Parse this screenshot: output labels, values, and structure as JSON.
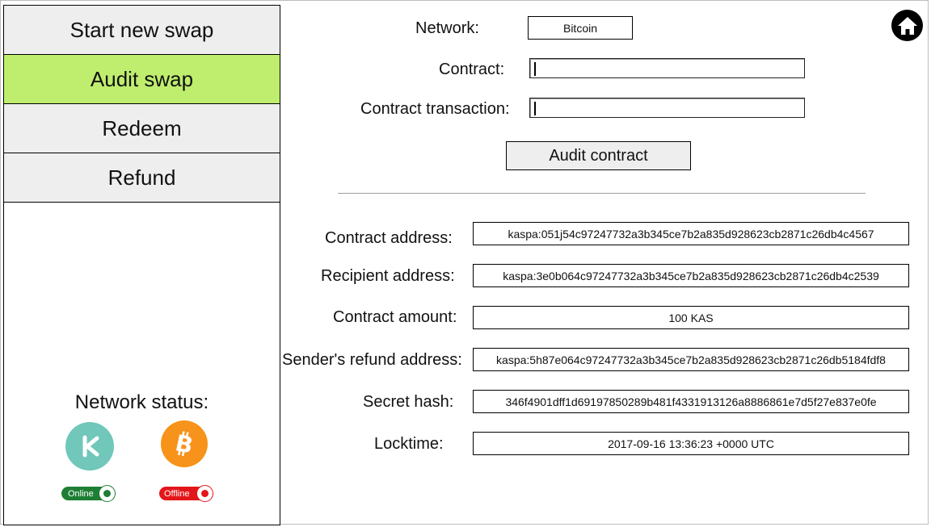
{
  "sidebar": {
    "items": [
      {
        "label": "Start new swap"
      },
      {
        "label": "Audit swap"
      },
      {
        "label": "Redeem"
      },
      {
        "label": "Refund"
      }
    ],
    "network_status_label": "Network status:",
    "kaspa_status": "Online",
    "bitcoin_status": "Offline"
  },
  "form": {
    "network_label": "Network:",
    "network_value": "Bitcoin",
    "contract_label": "Contract:",
    "contract_value": "",
    "contract_tx_label": "Contract transaction:",
    "contract_tx_value": "",
    "audit_button": "Audit contract"
  },
  "results": {
    "contract_address_label": "Contract address:",
    "contract_address": "kaspa:051j54c97247732a3b345ce7b2a835d928623cb2871c26db4c4567",
    "recipient_address_label": "Recipient address:",
    "recipient_address": "kaspa:3e0b064c97247732a3b345ce7b2a835d928623cb2871c26db4c2539",
    "contract_amount_label": "Contract amount:",
    "contract_amount": "100 KAS",
    "refund_address_label": "Sender's refund address:",
    "refund_address": "kaspa:5h87e064c97247732a3b345ce7b2a835d928623cb2871c26db5184fdf8",
    "secret_hash_label": "Secret hash:",
    "secret_hash": "346f4901dff1d69197850289b481f4331913126a8886861e7d5f27e837e0fe",
    "locktime_label": "Locktime:",
    "locktime": "2017-09-16 13:36:23 +0000 UTC"
  },
  "colors": {
    "active_nav": "#bfee6e",
    "online": "#1e7e34",
    "offline": "#e3161a",
    "kaspa": "#70c7ba",
    "bitcoin": "#f7931a"
  },
  "icons": [
    "home-icon",
    "kaspa-icon",
    "bitcoin-icon"
  ]
}
